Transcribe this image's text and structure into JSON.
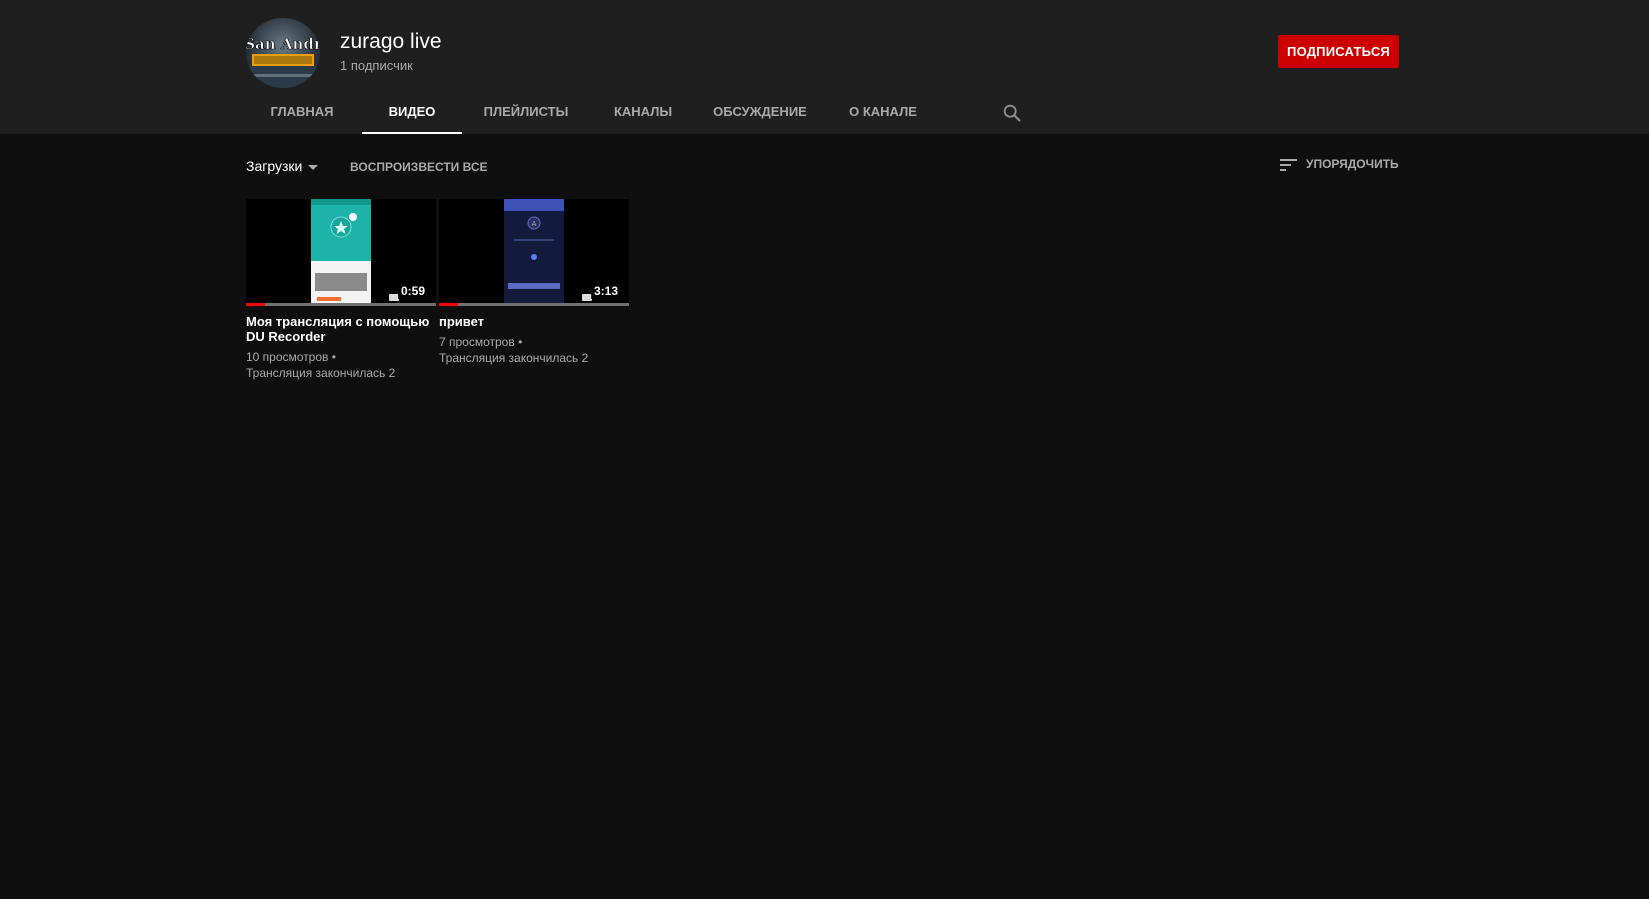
{
  "channel": {
    "name": "zurago live",
    "subscribers": "1 подписчик",
    "subscribe_label": "ПОДПИСАТЬСЯ",
    "avatar_logo_text": "San Andreas",
    "accent_color": "#cc0000"
  },
  "tabs": [
    {
      "label": "ГЛАВНАЯ",
      "active": false
    },
    {
      "label": "ВИДЕО",
      "active": true
    },
    {
      "label": "ПЛЕЙЛИСТЫ",
      "active": false
    },
    {
      "label": "КАНАЛЫ",
      "active": false
    },
    {
      "label": "ОБСУЖДЕНИЕ",
      "active": false
    },
    {
      "label": "О КАНАЛЕ",
      "active": false
    }
  ],
  "tab_search_icon": "search-icon",
  "subbar": {
    "uploads_label": "Загрузки",
    "play_all_label": "ВОСПРОИЗВЕСТИ ВСЕ",
    "sort_label": "УПОРЯДОЧИТЬ",
    "sort_icon": "sort-icon"
  },
  "videos": [
    {
      "title": "Моя трансляция с помощью DU Recorder",
      "views": "10 просмотров",
      "status": "Трансляция закончилась 2",
      "duration": "0:59",
      "watched_fraction": 0.1
    },
    {
      "title": "привет",
      "views": "7 просмотров",
      "status": "Трансляция закончилась 2",
      "duration": "3:13",
      "watched_fraction": 0.1
    }
  ]
}
